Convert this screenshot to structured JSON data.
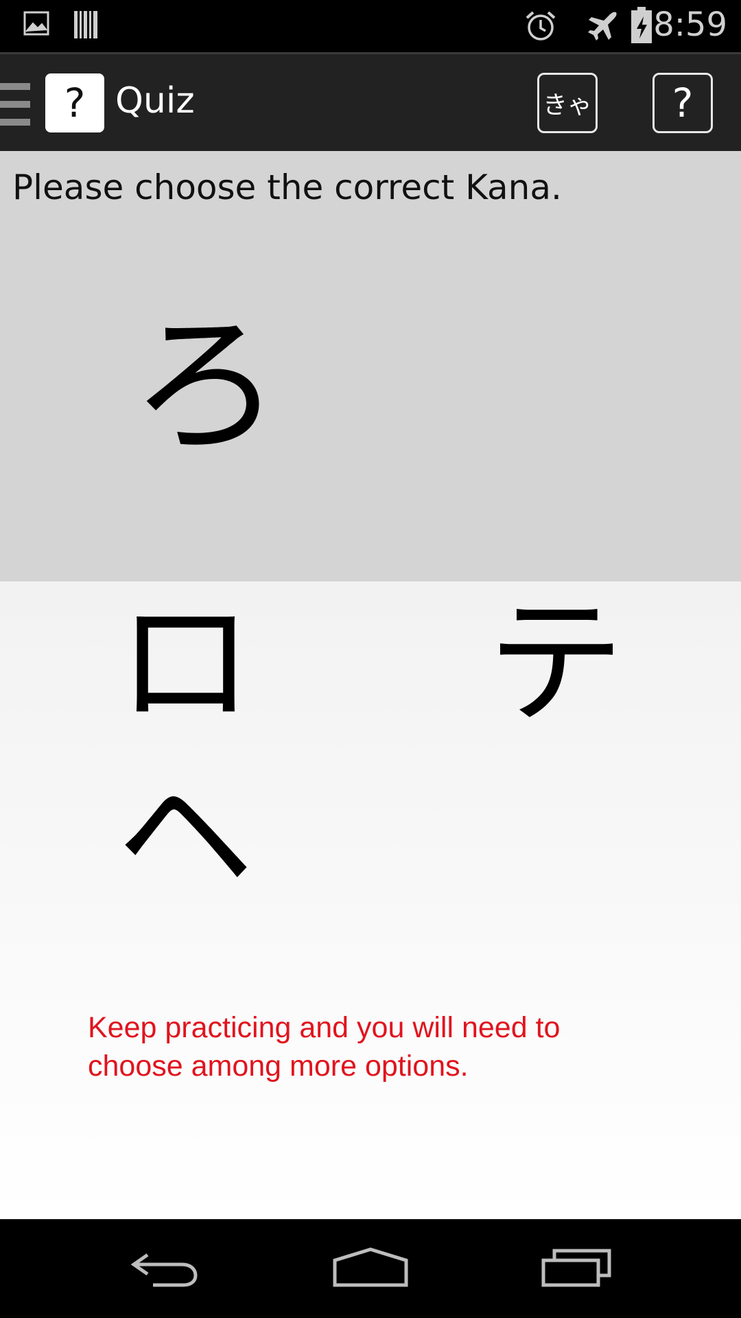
{
  "status_bar": {
    "time": "8:59",
    "icons": [
      "gallery-icon",
      "barcode-icon",
      "alarm-icon",
      "airplane-mode-icon",
      "battery-charging-icon"
    ]
  },
  "action_bar": {
    "app_icon_glyph": "?",
    "title": "Quiz",
    "kana_button_label": "きゃ",
    "help_button_label": "?"
  },
  "question": {
    "instruction": "Please choose the correct Kana.",
    "kana": "ろ"
  },
  "answers": [
    {
      "label": "ロ"
    },
    {
      "label": "テ"
    },
    {
      "label": "ヘ"
    }
  ],
  "hint": "Keep practicing and you will need to choose among more options.",
  "colors": {
    "hint_text": "#e0141e",
    "question_bg": "#d4d4d4",
    "action_bar_bg": "#222222"
  },
  "nav_bar": {
    "icons": [
      "back-icon",
      "home-icon",
      "recents-icon"
    ]
  }
}
